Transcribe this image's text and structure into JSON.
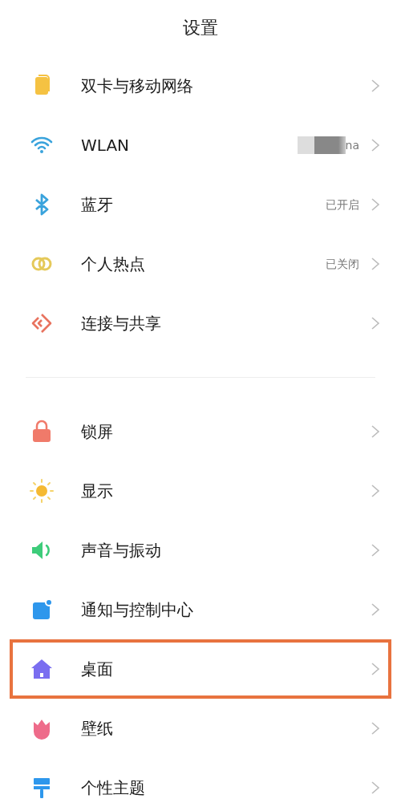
{
  "title": "设置",
  "groups": [
    {
      "items": [
        {
          "label": "双卡与移动网络",
          "highlighted": false
        },
        {
          "label": "WLAN",
          "value": "na",
          "redacted": true,
          "highlighted": false
        },
        {
          "label": "蓝牙",
          "value": "已开启",
          "highlighted": false
        },
        {
          "label": "个人热点",
          "value": "已关闭",
          "highlighted": false
        },
        {
          "label": "连接与共享",
          "highlighted": false
        }
      ]
    },
    {
      "items": [
        {
          "label": "锁屏",
          "highlighted": false
        },
        {
          "label": "显示",
          "highlighted": false
        },
        {
          "label": "声音与振动",
          "highlighted": false
        },
        {
          "label": "通知与控制中心",
          "highlighted": false
        },
        {
          "label": "桌面",
          "highlighted": true
        },
        {
          "label": "壁纸",
          "highlighted": false
        },
        {
          "label": "个性主题",
          "highlighted": false
        }
      ]
    }
  ]
}
